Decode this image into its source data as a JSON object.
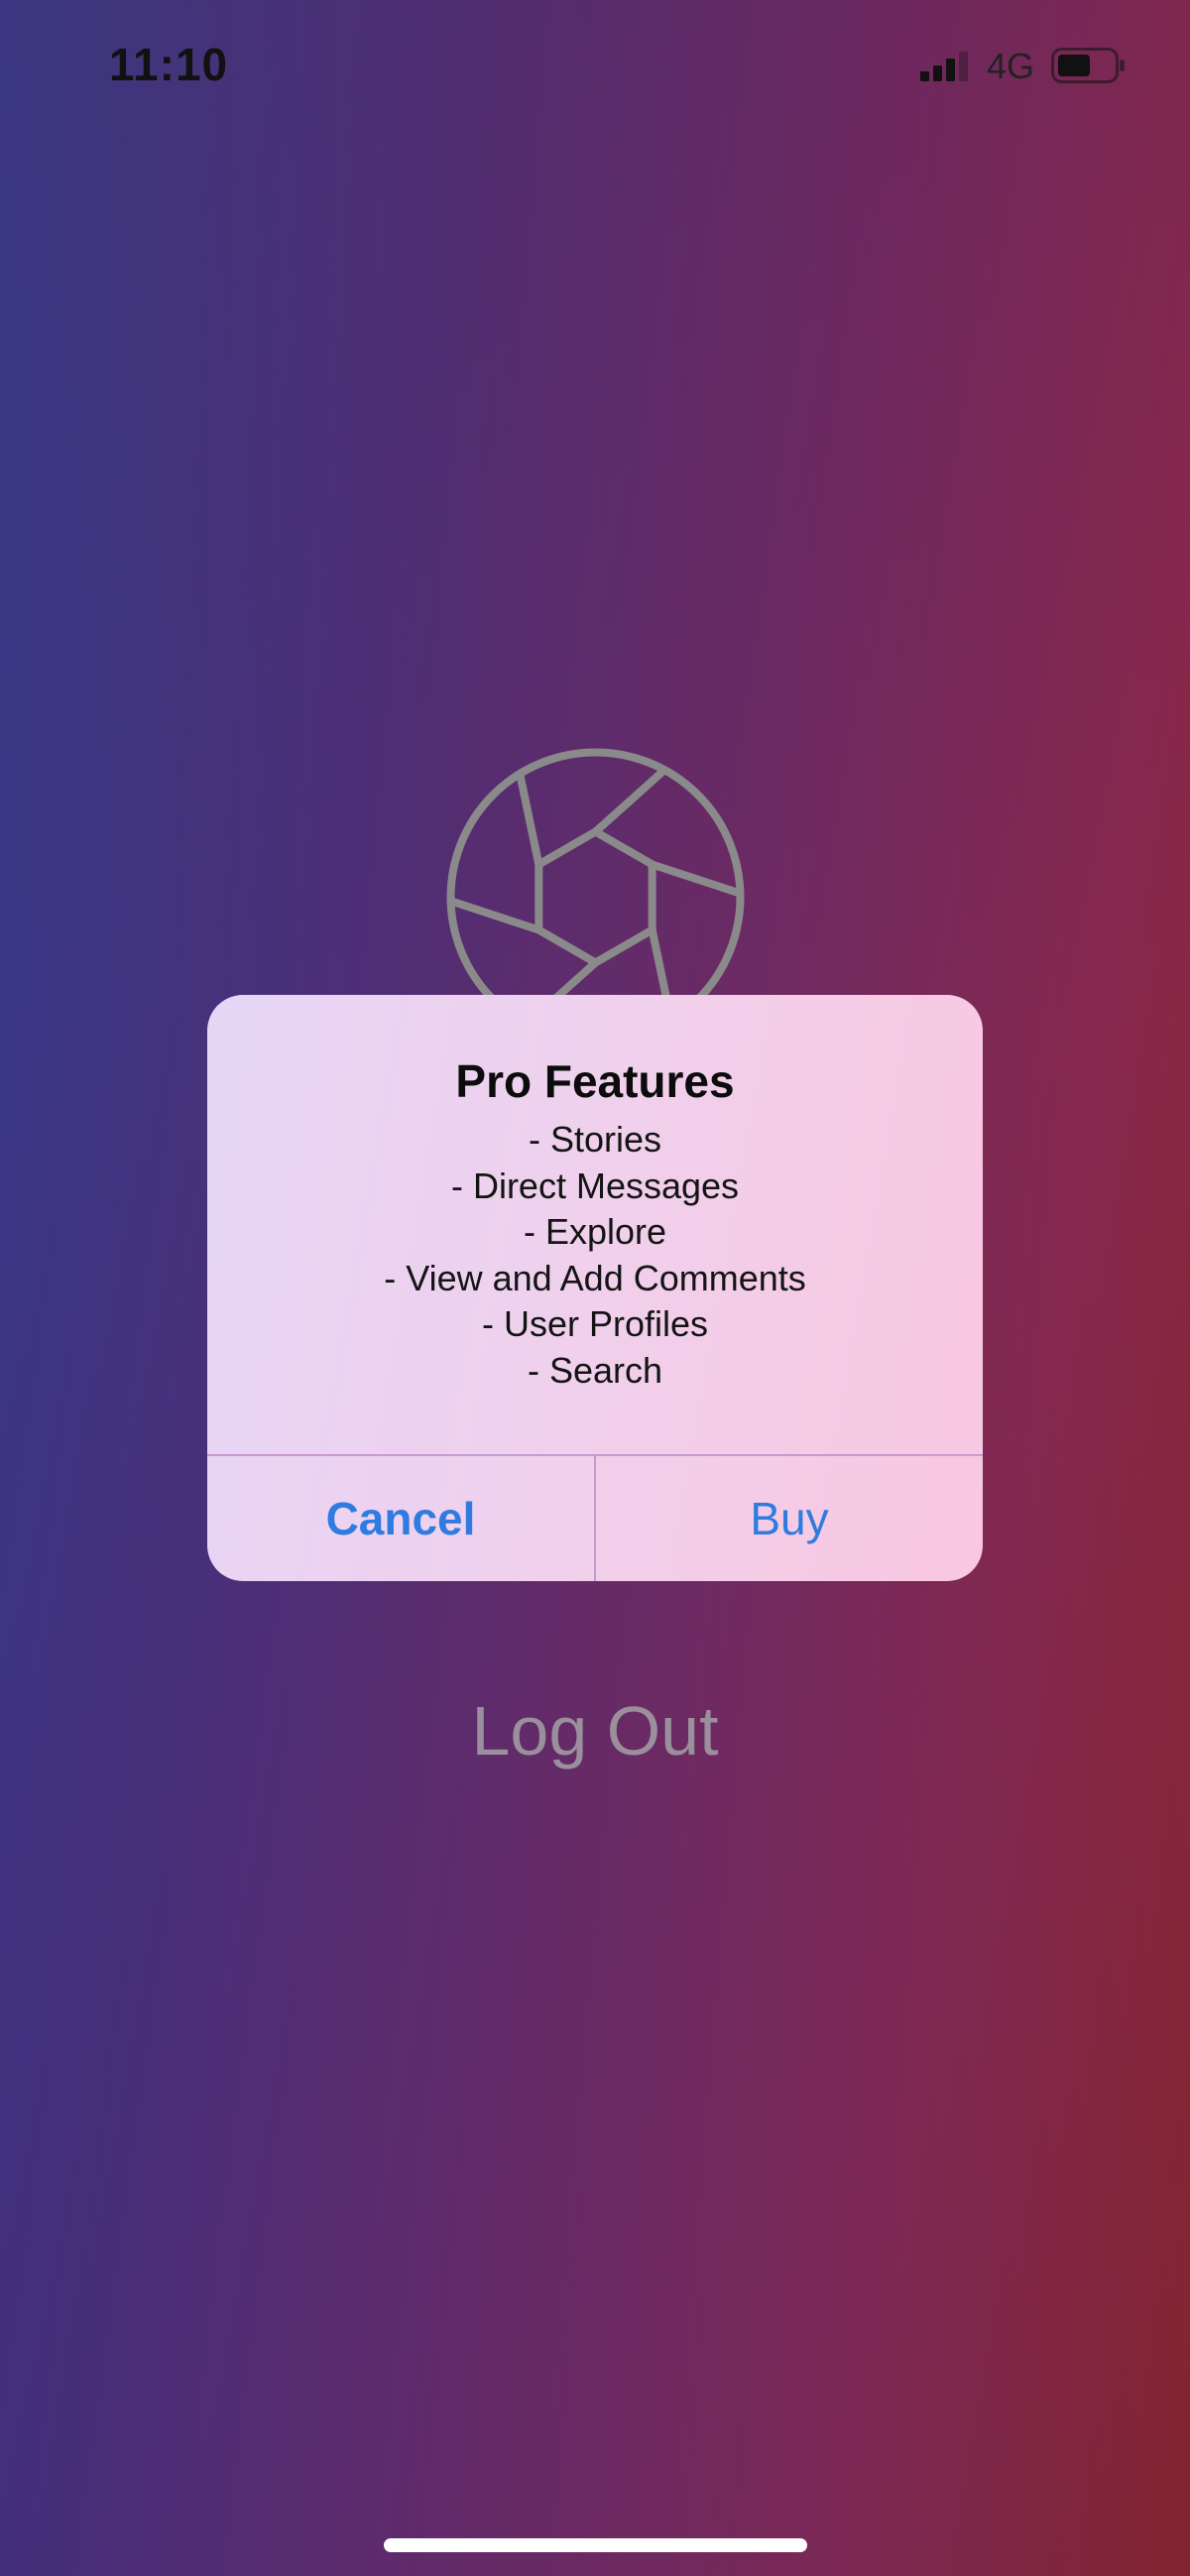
{
  "status_bar": {
    "time": "11:10",
    "network": "4G",
    "icons": [
      "signal-icon",
      "battery-icon"
    ]
  },
  "logo": {
    "icon": "aperture-icon",
    "color": "#8a8a8a"
  },
  "alert": {
    "title": "Pro Features",
    "lines": [
      "- Stories",
      "- Direct Messages",
      "- Explore",
      "- View and Add Comments",
      "- User Profiles",
      "- Search"
    ],
    "cancel_label": "Cancel",
    "buy_label": "Buy",
    "accent_color": "#2f7be0"
  },
  "logout": {
    "label": "Log Out"
  }
}
